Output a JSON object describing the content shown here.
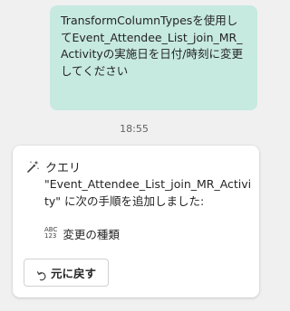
{
  "user_message": {
    "text": "TransformColumnTypesを使用してEvent_Attendee_List_join_MR_Activityの実施日を日付/時刻に変更してください"
  },
  "timestamp": "18:55",
  "response_card": {
    "title": "クエリ",
    "icon": "magic-wand-icon",
    "body": "\"Event_Attendee_List_join_MR_Activity\" に次の手順を追加しました:",
    "step": {
      "icon": "abc-123-icon",
      "icon_top": "ABC",
      "icon_bottom": "123",
      "label": "変更の種類"
    },
    "undo_button": {
      "icon": "undo-icon",
      "label": "元に戻す"
    }
  }
}
